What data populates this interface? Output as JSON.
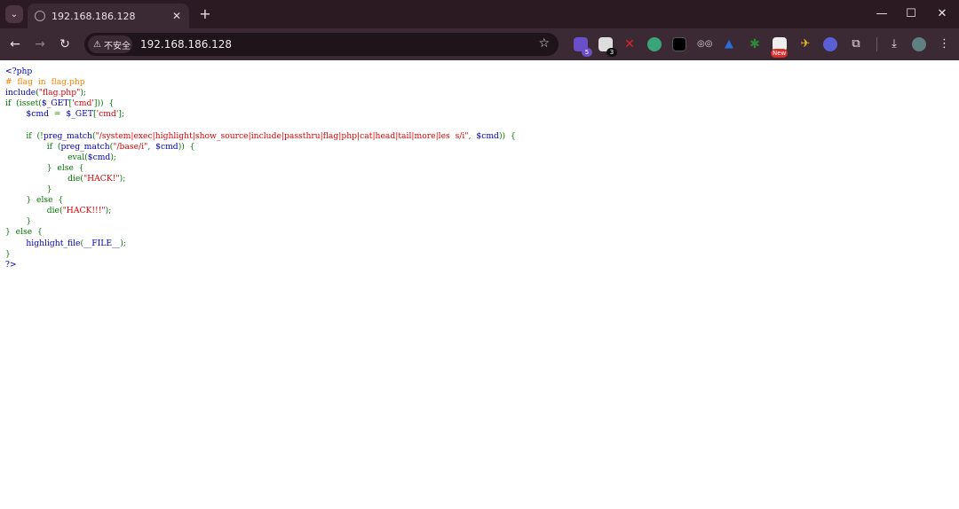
{
  "browser": {
    "tab_title": "192.168.186.128",
    "tab_close": "✕",
    "new_tab": "+",
    "tab_search": "⌄",
    "window_controls": [
      "—",
      "☐",
      "✕"
    ],
    "nav": {
      "back": "←",
      "forward": "→",
      "reload": "↻"
    },
    "security_label": "不安全",
    "security_icon": "warning-triangle-icon",
    "url": "192.168.186.128",
    "bookmark_icon": "star-icon",
    "extensions": [
      {
        "name": "purple-extension-icon",
        "color": "#6a4fc8",
        "badge": "5"
      },
      {
        "name": "white-cloud-extension-icon",
        "color": "#dddddd",
        "badge": "3"
      },
      {
        "name": "red-x-extension-icon",
        "color": "#e0202a",
        "badge": ""
      },
      {
        "name": "globe-extension-icon",
        "color": "#3aa57a",
        "badge": ""
      },
      {
        "name": "dark-square-extension-icon",
        "color": "#222222",
        "badge": ""
      },
      {
        "name": "glasses-extension-icon",
        "color": "#d8d8d8",
        "badge": ""
      },
      {
        "name": "blue-drop-extension-icon",
        "color": "#2a6bd6",
        "badge": ""
      },
      {
        "name": "green-bug-extension-icon",
        "color": "#2e8b3a",
        "badge": ""
      },
      {
        "name": "new-extension-icon",
        "color": "#d9302c",
        "badge": "New"
      },
      {
        "name": "yellow-bird-extension-icon",
        "color": "#e8b81c",
        "badge": ""
      },
      {
        "name": "blue-gear-extension-icon",
        "color": "#5b5fd6",
        "badge": ""
      },
      {
        "name": "puzzle-extensions-icon",
        "color": "#eae3e6",
        "badge": ""
      }
    ],
    "download_icon": "download-icon",
    "profile_icon": "avatar-icon"
  },
  "code": {
    "lines": [
      [
        {
          "c": "df",
          "t": "<?php"
        }
      ],
      [
        {
          "c": "cm",
          "t": "#  flag  in  flag.php"
        }
      ],
      [
        {
          "c": "df",
          "t": "include"
        },
        {
          "c": "kw",
          "t": "("
        },
        {
          "c": "st",
          "t": "\"flag.php\""
        },
        {
          "c": "kw",
          "t": ");"
        }
      ],
      [
        {
          "c": "kw",
          "t": "if  (isset("
        },
        {
          "c": "df",
          "t": "$_GET"
        },
        {
          "c": "kw",
          "t": "["
        },
        {
          "c": "st",
          "t": "'cmd'"
        },
        {
          "c": "kw",
          "t": "]))  {"
        }
      ],
      [
        {
          "c": "df",
          "t": "        $cmd"
        },
        {
          "c": "kw",
          "t": "  =  "
        },
        {
          "c": "df",
          "t": "$_GET"
        },
        {
          "c": "kw",
          "t": "["
        },
        {
          "c": "st",
          "t": "'cmd'"
        },
        {
          "c": "kw",
          "t": "];"
        }
      ],
      [
        {
          "c": "df",
          "t": ""
        }
      ],
      [
        {
          "c": "kw",
          "t": "        if  (!"
        },
        {
          "c": "df",
          "t": "preg_match"
        },
        {
          "c": "kw",
          "t": "("
        },
        {
          "c": "st",
          "t": "\"/system|exec|highlight|show_source|include|passthru|flag|php|cat|head|tail|more|les  s/i\""
        },
        {
          "c": "kw",
          "t": ",  "
        },
        {
          "c": "df",
          "t": "$cmd"
        },
        {
          "c": "kw",
          "t": "))  {"
        }
      ],
      [
        {
          "c": "kw",
          "t": "                if  ("
        },
        {
          "c": "df",
          "t": "preg_match"
        },
        {
          "c": "kw",
          "t": "("
        },
        {
          "c": "st",
          "t": "\"/base/i\""
        },
        {
          "c": "kw",
          "t": ",  "
        },
        {
          "c": "df",
          "t": "$cmd"
        },
        {
          "c": "kw",
          "t": "))  {"
        }
      ],
      [
        {
          "c": "kw",
          "t": "                        eval("
        },
        {
          "c": "df",
          "t": "$cmd"
        },
        {
          "c": "kw",
          "t": ");"
        }
      ],
      [
        {
          "c": "kw",
          "t": "                }  else  {"
        }
      ],
      [
        {
          "c": "kw",
          "t": "                        die("
        },
        {
          "c": "st",
          "t": "\"HACK!\""
        },
        {
          "c": "kw",
          "t": ");"
        }
      ],
      [
        {
          "c": "kw",
          "t": "                }"
        }
      ],
      [
        {
          "c": "kw",
          "t": "        }  else  {"
        }
      ],
      [
        {
          "c": "kw",
          "t": "                die("
        },
        {
          "c": "st",
          "t": "\"HACK!!!\""
        },
        {
          "c": "kw",
          "t": ");"
        }
      ],
      [
        {
          "c": "kw",
          "t": "        }"
        }
      ],
      [
        {
          "c": "kw",
          "t": "}  else  {"
        }
      ],
      [
        {
          "c": "df",
          "t": "        highlight_file"
        },
        {
          "c": "kw",
          "t": "("
        },
        {
          "c": "df",
          "t": "__FILE__"
        },
        {
          "c": "kw",
          "t": ");"
        }
      ],
      [
        {
          "c": "kw",
          "t": "}"
        }
      ],
      [
        {
          "c": "df",
          "t": "?>"
        }
      ]
    ]
  }
}
